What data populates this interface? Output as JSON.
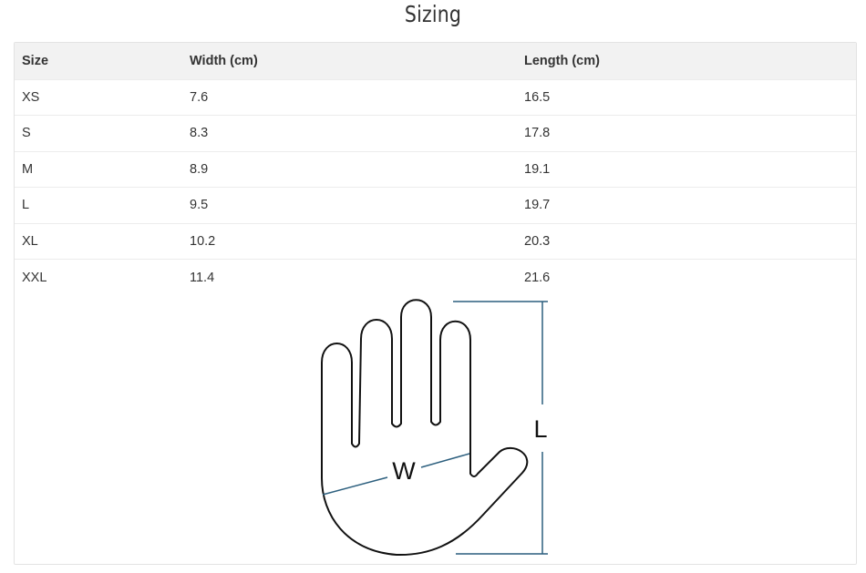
{
  "title": "Sizing",
  "table": {
    "headers": [
      "Size",
      "Width (cm)",
      "Length (cm)"
    ],
    "rows": [
      [
        "XS",
        "7.6",
        "16.5"
      ],
      [
        "S",
        "8.3",
        "17.8"
      ],
      [
        "M",
        "8.9",
        "19.1"
      ],
      [
        "L",
        "9.5",
        "19.7"
      ],
      [
        "XL",
        "10.2",
        "20.3"
      ],
      [
        "XXL",
        "11.4",
        "21.6"
      ]
    ]
  },
  "diagram": {
    "width_label": "W",
    "length_label": "L",
    "measure_color": "#2c5f7e",
    "outline_color": "#111111"
  }
}
